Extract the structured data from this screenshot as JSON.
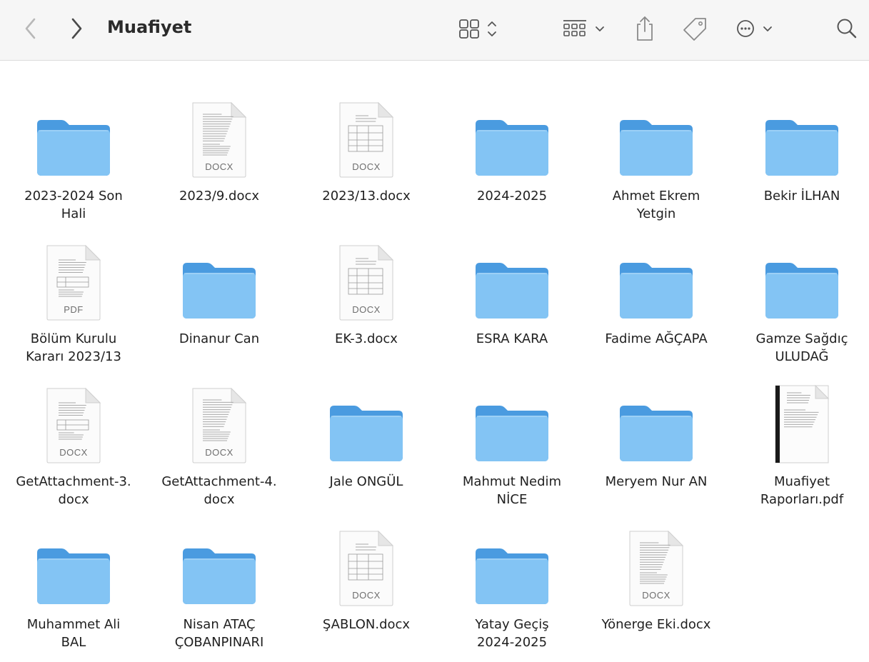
{
  "window": {
    "title": "Muafiyet"
  },
  "toolbar": {
    "back_icon": "chevron-left-icon",
    "forward_icon": "chevron-right-icon",
    "view_icon": "icon-grid-view-icon",
    "group_icon": "group-by-icon",
    "share_icon": "share-icon",
    "tag_icon": "tag-icon",
    "more_icon": "ellipsis-circle-icon",
    "search_icon": "search-icon"
  },
  "colors": {
    "folder_back": "#4a9be0",
    "folder_front": "#83c4f4",
    "toolbar_bg": "#f6f6f6"
  },
  "items": [
    {
      "name": "2023-2024 Son\nHali",
      "kind": "folder"
    },
    {
      "name": "2023/9.docx",
      "kind": "doc",
      "badge": "DOCX"
    },
    {
      "name": "2023/13.docx",
      "kind": "doc",
      "badge": "DOCX"
    },
    {
      "name": "2024-2025",
      "kind": "folder"
    },
    {
      "name": "Ahmet Ekrem\nYetgin",
      "kind": "folder"
    },
    {
      "name": "Bekir İLHAN",
      "kind": "folder"
    },
    {
      "name": "Bölüm Kurulu\nKararı 2023/13",
      "kind": "doc",
      "badge": "PDF"
    },
    {
      "name": "Dinanur Can",
      "kind": "folder"
    },
    {
      "name": "EK-3.docx",
      "kind": "doc",
      "badge": "DOCX"
    },
    {
      "name": "ESRA KARA",
      "kind": "folder"
    },
    {
      "name": "Fadime AĞÇAPA",
      "kind": "folder"
    },
    {
      "name": "Gamze Sağdıç\nULUDAĞ",
      "kind": "folder"
    },
    {
      "name": "GetAttachment-3.\ndocx",
      "kind": "doc",
      "badge": "DOCX"
    },
    {
      "name": "GetAttachment-4.\ndocx",
      "kind": "doc",
      "badge": "DOCX"
    },
    {
      "name": "Jale ONGÜL",
      "kind": "folder"
    },
    {
      "name": "Mahmut Nedim\nNİCE",
      "kind": "folder"
    },
    {
      "name": "Meryem Nur AN",
      "kind": "folder"
    },
    {
      "name": "Muafiyet\nRaporları.pdf",
      "kind": "pdf-preview"
    },
    {
      "name": "Muhammet Ali\nBAL",
      "kind": "folder"
    },
    {
      "name": "Nisan ATAÇ\nÇOBANPINARI",
      "kind": "folder"
    },
    {
      "name": "ŞABLON.docx",
      "kind": "doc",
      "badge": "DOCX"
    },
    {
      "name": "Yatay Geçiş\n2024-2025",
      "kind": "folder"
    },
    {
      "name": "Yönerge Eki.docx",
      "kind": "doc",
      "badge": "DOCX"
    }
  ]
}
